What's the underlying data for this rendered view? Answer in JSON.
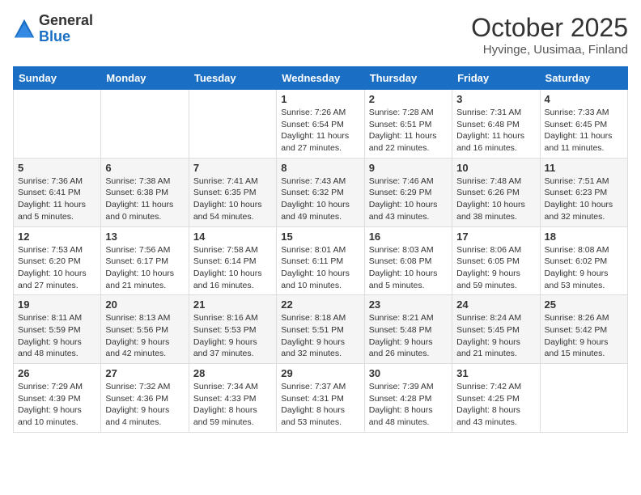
{
  "header": {
    "logo_general": "General",
    "logo_blue": "Blue",
    "title": "October 2025",
    "subtitle": "Hyvinge, Uusimaa, Finland"
  },
  "calendar": {
    "days_of_week": [
      "Sunday",
      "Monday",
      "Tuesday",
      "Wednesday",
      "Thursday",
      "Friday",
      "Saturday"
    ],
    "weeks": [
      [
        {
          "day": "",
          "info": ""
        },
        {
          "day": "",
          "info": ""
        },
        {
          "day": "",
          "info": ""
        },
        {
          "day": "1",
          "info": "Sunrise: 7:26 AM\nSunset: 6:54 PM\nDaylight: 11 hours\nand 27 minutes."
        },
        {
          "day": "2",
          "info": "Sunrise: 7:28 AM\nSunset: 6:51 PM\nDaylight: 11 hours\nand 22 minutes."
        },
        {
          "day": "3",
          "info": "Sunrise: 7:31 AM\nSunset: 6:48 PM\nDaylight: 11 hours\nand 16 minutes."
        },
        {
          "day": "4",
          "info": "Sunrise: 7:33 AM\nSunset: 6:45 PM\nDaylight: 11 hours\nand 11 minutes."
        }
      ],
      [
        {
          "day": "5",
          "info": "Sunrise: 7:36 AM\nSunset: 6:41 PM\nDaylight: 11 hours\nand 5 minutes."
        },
        {
          "day": "6",
          "info": "Sunrise: 7:38 AM\nSunset: 6:38 PM\nDaylight: 11 hours\nand 0 minutes."
        },
        {
          "day": "7",
          "info": "Sunrise: 7:41 AM\nSunset: 6:35 PM\nDaylight: 10 hours\nand 54 minutes."
        },
        {
          "day": "8",
          "info": "Sunrise: 7:43 AM\nSunset: 6:32 PM\nDaylight: 10 hours\nand 49 minutes."
        },
        {
          "day": "9",
          "info": "Sunrise: 7:46 AM\nSunset: 6:29 PM\nDaylight: 10 hours\nand 43 minutes."
        },
        {
          "day": "10",
          "info": "Sunrise: 7:48 AM\nSunset: 6:26 PM\nDaylight: 10 hours\nand 38 minutes."
        },
        {
          "day": "11",
          "info": "Sunrise: 7:51 AM\nSunset: 6:23 PM\nDaylight: 10 hours\nand 32 minutes."
        }
      ],
      [
        {
          "day": "12",
          "info": "Sunrise: 7:53 AM\nSunset: 6:20 PM\nDaylight: 10 hours\nand 27 minutes."
        },
        {
          "day": "13",
          "info": "Sunrise: 7:56 AM\nSunset: 6:17 PM\nDaylight: 10 hours\nand 21 minutes."
        },
        {
          "day": "14",
          "info": "Sunrise: 7:58 AM\nSunset: 6:14 PM\nDaylight: 10 hours\nand 16 minutes."
        },
        {
          "day": "15",
          "info": "Sunrise: 8:01 AM\nSunset: 6:11 PM\nDaylight: 10 hours\nand 10 minutes."
        },
        {
          "day": "16",
          "info": "Sunrise: 8:03 AM\nSunset: 6:08 PM\nDaylight: 10 hours\nand 5 minutes."
        },
        {
          "day": "17",
          "info": "Sunrise: 8:06 AM\nSunset: 6:05 PM\nDaylight: 9 hours\nand 59 minutes."
        },
        {
          "day": "18",
          "info": "Sunrise: 8:08 AM\nSunset: 6:02 PM\nDaylight: 9 hours\nand 53 minutes."
        }
      ],
      [
        {
          "day": "19",
          "info": "Sunrise: 8:11 AM\nSunset: 5:59 PM\nDaylight: 9 hours\nand 48 minutes."
        },
        {
          "day": "20",
          "info": "Sunrise: 8:13 AM\nSunset: 5:56 PM\nDaylight: 9 hours\nand 42 minutes."
        },
        {
          "day": "21",
          "info": "Sunrise: 8:16 AM\nSunset: 5:53 PM\nDaylight: 9 hours\nand 37 minutes."
        },
        {
          "day": "22",
          "info": "Sunrise: 8:18 AM\nSunset: 5:51 PM\nDaylight: 9 hours\nand 32 minutes."
        },
        {
          "day": "23",
          "info": "Sunrise: 8:21 AM\nSunset: 5:48 PM\nDaylight: 9 hours\nand 26 minutes."
        },
        {
          "day": "24",
          "info": "Sunrise: 8:24 AM\nSunset: 5:45 PM\nDaylight: 9 hours\nand 21 minutes."
        },
        {
          "day": "25",
          "info": "Sunrise: 8:26 AM\nSunset: 5:42 PM\nDaylight: 9 hours\nand 15 minutes."
        }
      ],
      [
        {
          "day": "26",
          "info": "Sunrise: 7:29 AM\nSunset: 4:39 PM\nDaylight: 9 hours\nand 10 minutes."
        },
        {
          "day": "27",
          "info": "Sunrise: 7:32 AM\nSunset: 4:36 PM\nDaylight: 9 hours\nand 4 minutes."
        },
        {
          "day": "28",
          "info": "Sunrise: 7:34 AM\nSunset: 4:33 PM\nDaylight: 8 hours\nand 59 minutes."
        },
        {
          "day": "29",
          "info": "Sunrise: 7:37 AM\nSunset: 4:31 PM\nDaylight: 8 hours\nand 53 minutes."
        },
        {
          "day": "30",
          "info": "Sunrise: 7:39 AM\nSunset: 4:28 PM\nDaylight: 8 hours\nand 48 minutes."
        },
        {
          "day": "31",
          "info": "Sunrise: 7:42 AM\nSunset: 4:25 PM\nDaylight: 8 hours\nand 43 minutes."
        },
        {
          "day": "",
          "info": ""
        }
      ]
    ]
  }
}
